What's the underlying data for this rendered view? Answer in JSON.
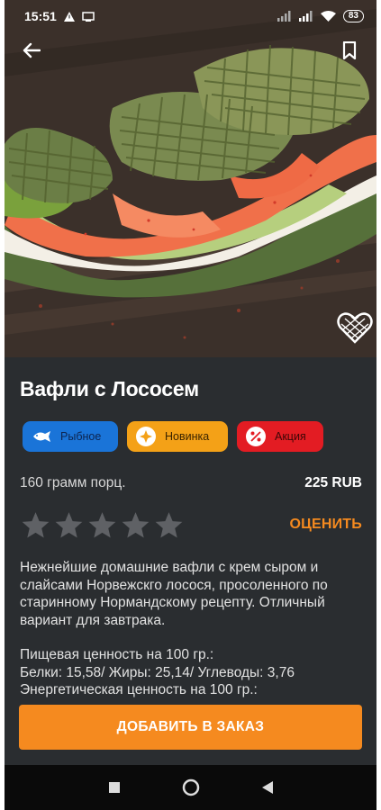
{
  "status_bar": {
    "time": "15:51",
    "battery": "83",
    "icons": [
      "warning-icon",
      "cast-icon",
      "signal-icon",
      "wifi-icon",
      "battery-icon"
    ]
  },
  "header": {
    "back_icon": "arrow-left-icon",
    "bookmark_icon": "bookmark-icon"
  },
  "product": {
    "title": "Вафли с Лососем",
    "tags": [
      {
        "label": "Рыбное",
        "icon": "fish-icon",
        "color": "#1a74d8"
      },
      {
        "label": "Новинка",
        "icon": "star-burst-icon",
        "color": "#f4a117"
      },
      {
        "label": "Акция",
        "icon": "percent-badge-icon",
        "color": "#e31c23"
      }
    ],
    "portion": "160 грамм порц.",
    "price": "225 RUB",
    "rating": {
      "value": 0,
      "max": 5
    },
    "rate_label": "ОЦЕНИТЬ",
    "description": "Нежнейшие домашние вафли с крем сыром и слайсами Норвежскго лосося,  просоленного по старинному Нормандскому рецепту. Отличный вариант для завтрака.",
    "nutrition_line1": "Пищевая ценность на 100 гр.:",
    "nutrition_line2": "Белки: 15,58/ Жиры: 25,14/ Углеводы: 3,76",
    "nutrition_line3": "Энергетическая ценность на 100 гр.:",
    "add_button": "ДОБАВИТЬ В ЗАКАЗ"
  },
  "colors": {
    "accent": "#f58a1f",
    "background": "#2a2d30",
    "star_inactive": "#5f6165"
  }
}
